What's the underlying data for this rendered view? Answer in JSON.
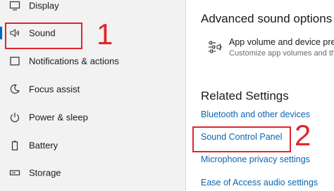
{
  "sidebar": {
    "items": [
      {
        "label": "Display",
        "icon": "display-icon"
      },
      {
        "label": "Sound",
        "icon": "speaker-icon",
        "selected": true
      },
      {
        "label": "Notifications & actions",
        "icon": "notifications-icon"
      },
      {
        "label": "Focus assist",
        "icon": "moon-icon"
      },
      {
        "label": "Power & sleep",
        "icon": "power-icon"
      },
      {
        "label": "Battery",
        "icon": "battery-icon"
      },
      {
        "label": "Storage",
        "icon": "storage-icon"
      }
    ]
  },
  "main": {
    "advanced_title": "Advanced sound options",
    "app_volume": {
      "title": "App volume and device prefe",
      "subtitle": "Customize app volumes and the",
      "icon": "sliders-speaker-icon"
    },
    "related_title": "Related Settings",
    "links": [
      "Bluetooth and other devices",
      "Sound Control Panel",
      "Microphone privacy settings",
      "Ease of Access audio settings"
    ]
  },
  "annotations": {
    "step1": "1",
    "step2": "2"
  },
  "colors": {
    "accent": "#0067c0",
    "link": "#0a64b4",
    "annotation": "#e0262b",
    "sidebar_bg": "#f2f2f2"
  }
}
